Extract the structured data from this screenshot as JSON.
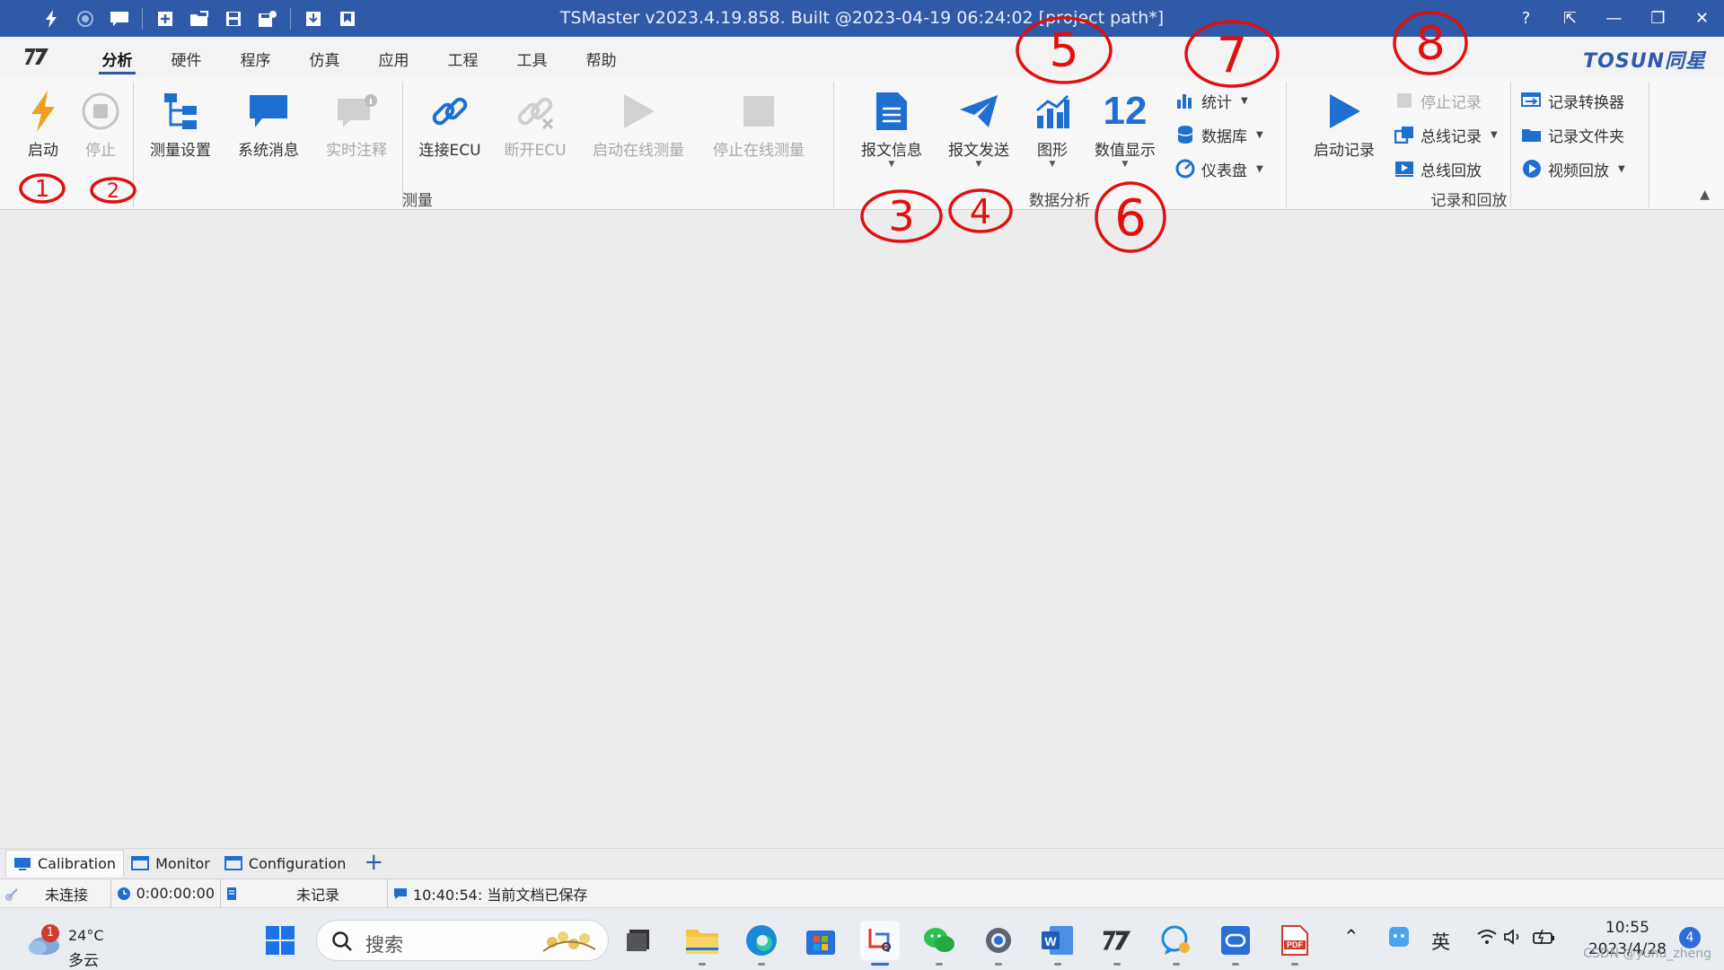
{
  "window": {
    "title": "TSMaster v2023.4.19.858. Built @2023-04-19 06:24:02 [project path*]",
    "controls": [
      "?",
      "⇱",
      "—",
      "❐",
      "✕"
    ]
  },
  "menu": {
    "tabs": [
      "分析",
      "硬件",
      "程序",
      "仿真",
      "应用",
      "工程",
      "工具",
      "帮助"
    ],
    "active_tab": "分析",
    "brand": "TOSUN同星"
  },
  "ribbon": {
    "measure": {
      "start": "启动",
      "stop": "停止",
      "measure_setup": "测量设置",
      "system_msg": "系统消息",
      "realtime_comment": "实时注释",
      "connect_ecu": "连接ECU",
      "disconnect_ecu": "断开ECU",
      "start_online": "启动在线测量",
      "stop_online": "停止在线测量",
      "group_label": "测量"
    },
    "analysis": {
      "msg_info": "报文信息",
      "msg_send": "报文发送",
      "graphics": "图形",
      "value_display_icon": "12",
      "value_display": "数值显示",
      "stats": "统计",
      "database": "数据库",
      "dashboard": "仪表盘",
      "group_label": "数据分析"
    },
    "record": {
      "start_record": "启动记录",
      "stop_record": "停止记录",
      "bus_record": "总线记录",
      "bus_playback": "总线回放",
      "record_converter": "记录转换器",
      "record_folder": "记录文件夹",
      "video_playback": "视频回放",
      "group_label": "记录和回放"
    }
  },
  "bottom_tabs": [
    "Calibration",
    "Monitor",
    "Configuration"
  ],
  "status": {
    "connection": "未连接",
    "time": "0:00:00:00",
    "record": "未记录",
    "message": "10:40:54: 当前文档已保存"
  },
  "taskbar": {
    "weather_temp": "24°C",
    "weather_cond": "多云",
    "weather_badge": "1",
    "search_placeholder": "搜索",
    "ime": "英",
    "time": "10:55",
    "date": "2023/4/28",
    "notifications": "4",
    "watermark": "CSDN @yuhu_zheng"
  },
  "annotations": [
    "1",
    "2",
    "3",
    "4",
    "5",
    "6",
    "7",
    "8"
  ],
  "colors": {
    "titlebar": "#2f5aa8",
    "accent_blue": "#1f6fd1",
    "start_orange": "#f0a020",
    "annotation_red": "#e01010"
  }
}
